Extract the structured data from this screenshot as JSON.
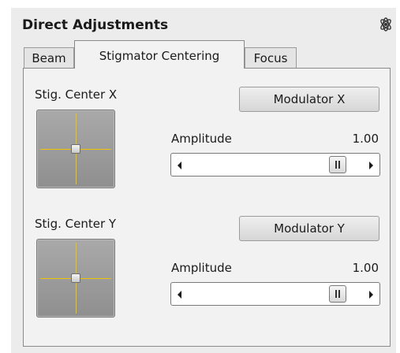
{
  "panel": {
    "title": "Direct Adjustments",
    "pin_icon": "atom-pin-icon"
  },
  "tabs": [
    {
      "label": "Beam",
      "active": false
    },
    {
      "label": "Stigmator Centering",
      "active": true
    },
    {
      "label": "Focus",
      "active": false
    }
  ],
  "stig_x": {
    "label": "Stig. Center X",
    "button": "Modulator X",
    "amplitude_label": "Amplitude",
    "amplitude_value": "1.00",
    "slider_fraction": 0.88
  },
  "stig_y": {
    "label": "Stig. Center Y",
    "button": "Modulator Y",
    "amplitude_label": "Amplitude",
    "amplitude_value": "1.00",
    "slider_fraction": 0.88
  },
  "colors": {
    "crosshair": "#f0c400",
    "panel_bg": "#ececec",
    "pad_bg": "#9a9a9a"
  }
}
